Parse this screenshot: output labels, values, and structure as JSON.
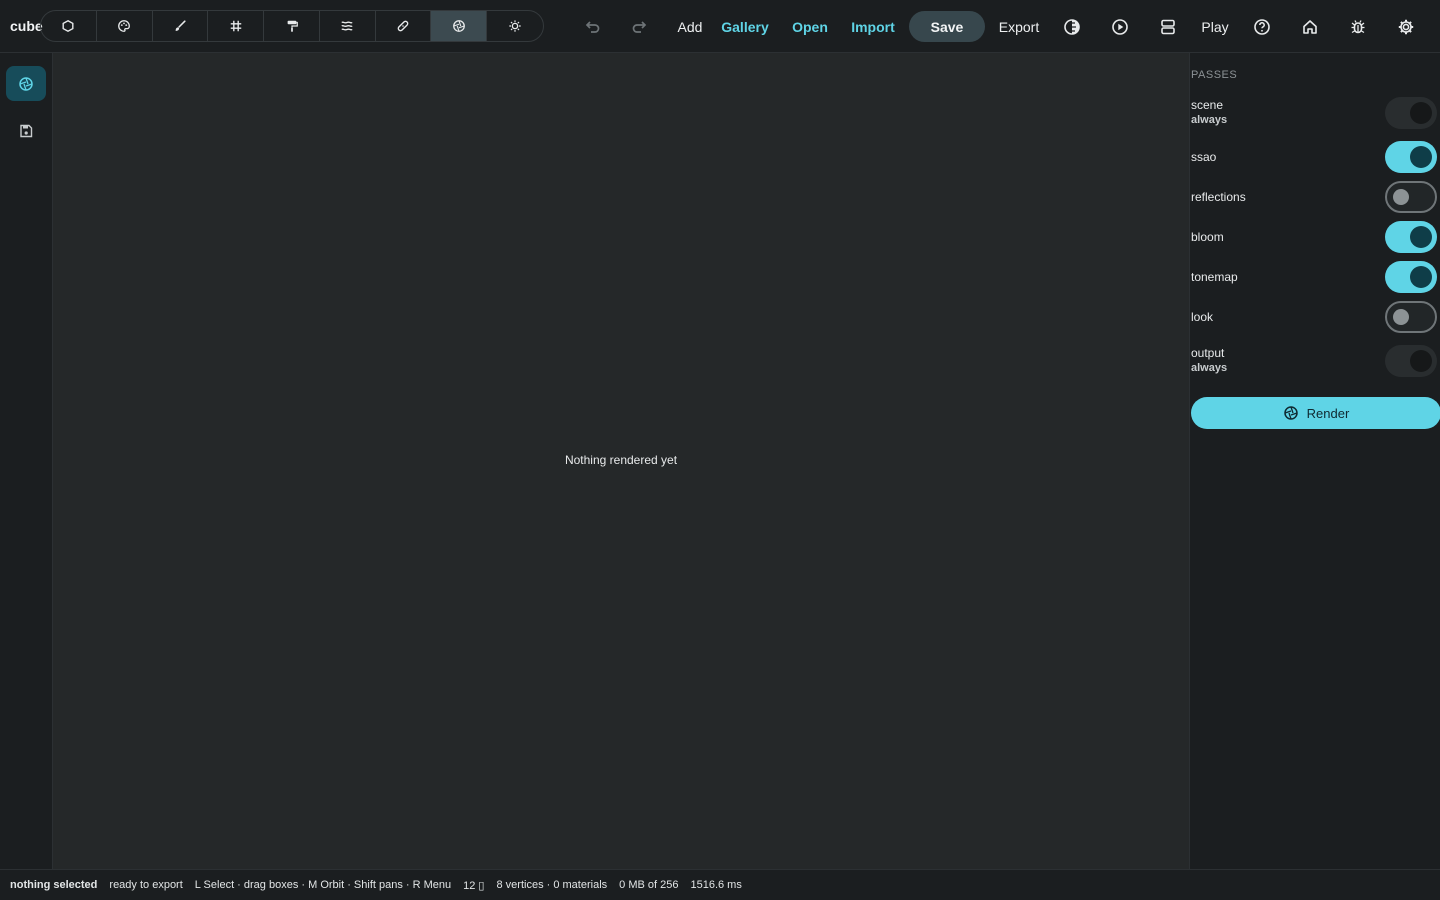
{
  "app": {
    "title": "cube"
  },
  "toolbar": {
    "tools": [
      {
        "icon": "shape-icon",
        "active": false
      },
      {
        "icon": "palette-icon",
        "active": false
      },
      {
        "icon": "brush-icon",
        "active": false
      },
      {
        "icon": "grid-icon",
        "active": false
      },
      {
        "icon": "paint-roller-icon",
        "active": false
      },
      {
        "icon": "waves-icon",
        "active": false
      },
      {
        "icon": "bandage-icon",
        "active": false
      },
      {
        "icon": "aperture-icon",
        "active": true
      },
      {
        "icon": "sun-icon",
        "active": false
      }
    ],
    "add_label": "Add",
    "gallery_label": "Gallery",
    "open_label": "Open",
    "import_label": "Import",
    "save_label": "Save",
    "export_label": "Export",
    "play_label": "Play"
  },
  "viewport": {
    "empty_message": "Nothing rendered yet"
  },
  "panel": {
    "heading": "PASSES",
    "passes": [
      {
        "name": "scene",
        "sub": "always",
        "state": "locked"
      },
      {
        "name": "ssao",
        "sub": "",
        "state": "on"
      },
      {
        "name": "reflections",
        "sub": "",
        "state": "off"
      },
      {
        "name": "bloom",
        "sub": "",
        "state": "on"
      },
      {
        "name": "tonemap",
        "sub": "",
        "state": "on"
      },
      {
        "name": "look",
        "sub": "",
        "state": "off"
      },
      {
        "name": "output",
        "sub": "always",
        "state": "locked"
      }
    ],
    "render_label": "Render"
  },
  "status": {
    "selection": "nothing selected",
    "export_state": "ready to export",
    "hints": "L Select · drag boxes · M Orbit · Shift pans · R Menu",
    "count": "12 ▯",
    "geometry": "8 vertices · 0 materials",
    "memory": "0 MB of 256",
    "timing": "1516.6 ms"
  },
  "colors": {
    "accent": "#5fd4e6",
    "background": "#1b1e20",
    "viewport": "#252829"
  }
}
